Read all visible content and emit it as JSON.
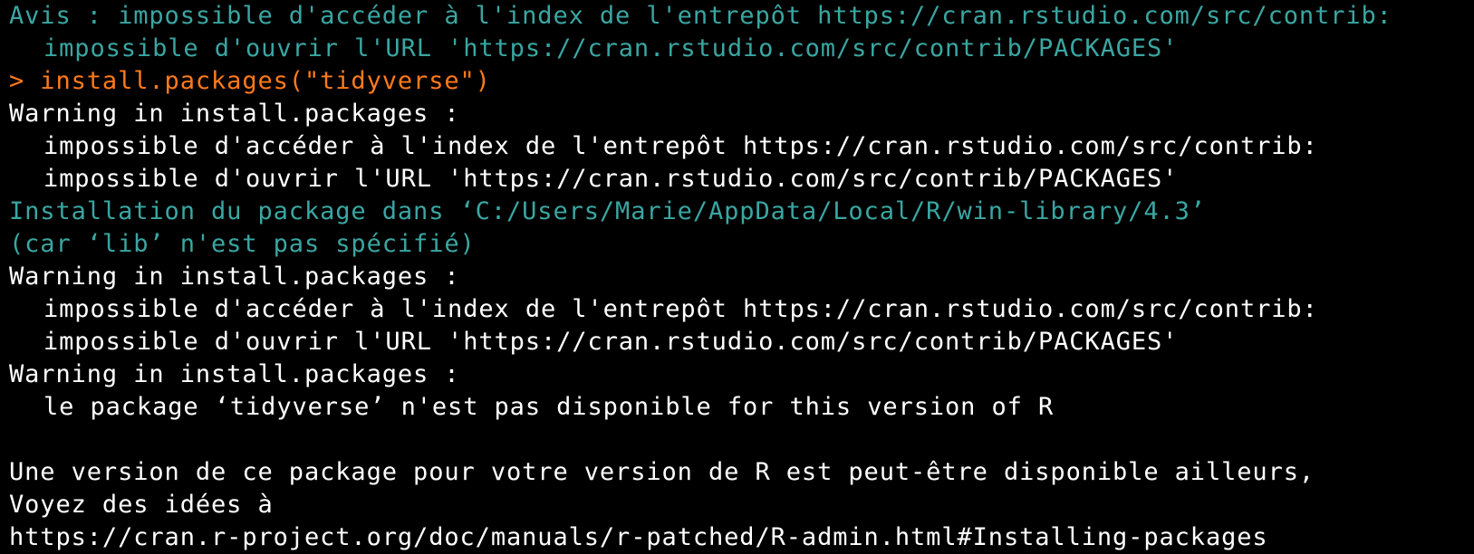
{
  "colors": {
    "background": "#000000",
    "info_text": "#3aa6a2",
    "command_input": "#ff7a1a",
    "output_text": "#ffffff"
  },
  "console": {
    "lines": [
      {
        "text": "Avis : impossible d'accéder à l'index de l'entrepôt https://cran.rstudio.com/src/contrib:"
      },
      {
        "text": "impossible d'ouvrir l'URL 'https://cran.rstudio.com/src/contrib/PACKAGES'"
      },
      {
        "text": "> install.packages(\"tidyverse\")"
      },
      {
        "text": "Warning in install.packages :"
      },
      {
        "text": "impossible d'accéder à l'index de l'entrepôt https://cran.rstudio.com/src/contrib:"
      },
      {
        "text": "impossible d'ouvrir l'URL 'https://cran.rstudio.com/src/contrib/PACKAGES'"
      },
      {
        "text": "Installation du package dans ‘C:/Users/Marie/AppData/Local/R/win-library/4.3’"
      },
      {
        "text": "(car ‘lib’ n'est pas spécifié)"
      },
      {
        "text": "Warning in install.packages :"
      },
      {
        "text": "impossible d'accéder à l'index de l'entrepôt https://cran.rstudio.com/src/contrib:"
      },
      {
        "text": "impossible d'ouvrir l'URL 'https://cran.rstudio.com/src/contrib/PACKAGES'"
      },
      {
        "text": "Warning in install.packages :"
      },
      {
        "text": "le package ‘tidyverse’ n'est pas disponible for this version of R"
      },
      {
        "text": "Une version de ce package pour votre version de R est peut-être disponible ailleurs,"
      },
      {
        "text": "Voyez des idées à"
      },
      {
        "text": "https://cran.r-project.org/doc/manuals/r-patched/R-admin.html#Installing-packages"
      }
    ]
  }
}
